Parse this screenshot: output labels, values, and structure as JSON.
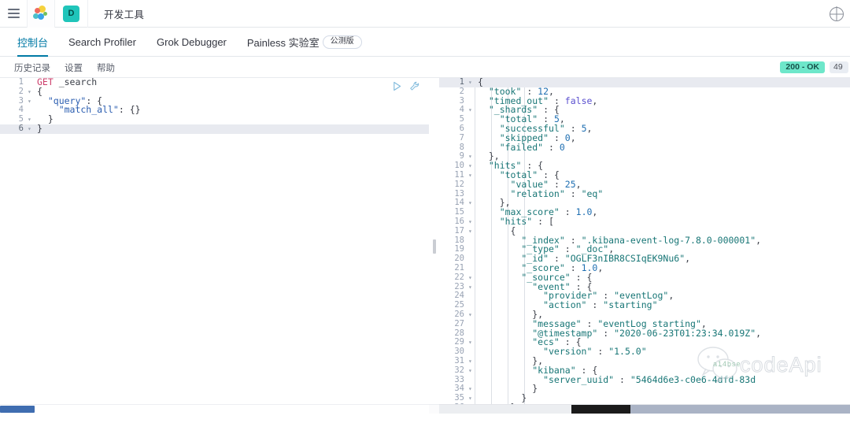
{
  "header": {
    "menu_icon": "hamburger-menu-icon",
    "logo_icon": "kibana-logo-icon",
    "space_badge": "D",
    "breadcrumb": "开发工具",
    "right_icon": "globe-icon"
  },
  "app_tabs": [
    {
      "label": "控制台",
      "active": true
    },
    {
      "label": "Search Profiler",
      "active": false
    },
    {
      "label": "Grok Debugger",
      "active": false
    },
    {
      "label": "Painless 实验室",
      "active": false
    }
  ],
  "beta_badge": "公测版",
  "console_toolbar": {
    "items": [
      "历史记录",
      "设置",
      "帮助"
    ],
    "status": "200 - OK",
    "time": "49",
    "status_color": "#6ee7ca"
  },
  "editor_actions": {
    "play": "play-icon",
    "wrench": "wrench-icon"
  },
  "request_editor": {
    "lines": [
      {
        "num": "1",
        "fold": "",
        "current": false,
        "parts": [
          {
            "t": "GET",
            "c": "tok-method"
          },
          {
            "t": " _search",
            "c": "tok-url"
          }
        ]
      },
      {
        "num": "2",
        "fold": "▾",
        "current": false,
        "parts": [
          {
            "t": "{",
            "c": "tok-punct"
          }
        ]
      },
      {
        "num": "3",
        "fold": "▾",
        "current": false,
        "parts": [
          {
            "t": "  \"query\"",
            "c": "tok-key"
          },
          {
            "t": ": {",
            "c": "tok-punct"
          }
        ]
      },
      {
        "num": "4",
        "fold": "",
        "current": false,
        "parts": [
          {
            "t": "    \"match_all\"",
            "c": "tok-key"
          },
          {
            "t": ": {}",
            "c": "tok-punct"
          }
        ]
      },
      {
        "num": "5",
        "fold": "▾",
        "current": false,
        "parts": [
          {
            "t": "  }",
            "c": "tok-punct"
          }
        ]
      },
      {
        "num": "6",
        "fold": "▾",
        "current": true,
        "parts": [
          {
            "t": "}",
            "c": "tok-punct"
          }
        ]
      }
    ]
  },
  "response_editor": {
    "lines": [
      {
        "num": "1",
        "fold": "▾",
        "current": true,
        "parts": [
          {
            "t": "{",
            "c": "r-punct"
          }
        ]
      },
      {
        "num": "2",
        "fold": "",
        "current": false,
        "parts": [
          {
            "t": "  \"took\"",
            "c": "r-key"
          },
          {
            "t": " : ",
            "c": "r-punct"
          },
          {
            "t": "12",
            "c": "r-num"
          },
          {
            "t": ",",
            "c": "r-punct"
          }
        ]
      },
      {
        "num": "3",
        "fold": "",
        "current": false,
        "parts": [
          {
            "t": "  \"timed_out\"",
            "c": "r-key"
          },
          {
            "t": " : ",
            "c": "r-punct"
          },
          {
            "t": "false",
            "c": "r-bool"
          },
          {
            "t": ",",
            "c": "r-punct"
          }
        ]
      },
      {
        "num": "4",
        "fold": "▾",
        "current": false,
        "parts": [
          {
            "t": "  \"_shards\"",
            "c": "r-key"
          },
          {
            "t": " : {",
            "c": "r-punct"
          }
        ]
      },
      {
        "num": "5",
        "fold": "",
        "current": false,
        "parts": [
          {
            "t": "    \"total\"",
            "c": "r-key"
          },
          {
            "t": " : ",
            "c": "r-punct"
          },
          {
            "t": "5",
            "c": "r-num"
          },
          {
            "t": ",",
            "c": "r-punct"
          }
        ]
      },
      {
        "num": "6",
        "fold": "",
        "current": false,
        "parts": [
          {
            "t": "    \"successful\"",
            "c": "r-key"
          },
          {
            "t": " : ",
            "c": "r-punct"
          },
          {
            "t": "5",
            "c": "r-num"
          },
          {
            "t": ",",
            "c": "r-punct"
          }
        ]
      },
      {
        "num": "7",
        "fold": "",
        "current": false,
        "parts": [
          {
            "t": "    \"skipped\"",
            "c": "r-key"
          },
          {
            "t": " : ",
            "c": "r-punct"
          },
          {
            "t": "0",
            "c": "r-num"
          },
          {
            "t": ",",
            "c": "r-punct"
          }
        ]
      },
      {
        "num": "8",
        "fold": "",
        "current": false,
        "parts": [
          {
            "t": "    \"failed\"",
            "c": "r-key"
          },
          {
            "t": " : ",
            "c": "r-punct"
          },
          {
            "t": "0",
            "c": "r-num"
          }
        ]
      },
      {
        "num": "9",
        "fold": "▾",
        "current": false,
        "parts": [
          {
            "t": "  },",
            "c": "r-punct"
          }
        ]
      },
      {
        "num": "10",
        "fold": "▾",
        "current": false,
        "parts": [
          {
            "t": "  \"hits\"",
            "c": "r-key"
          },
          {
            "t": " : {",
            "c": "r-punct"
          }
        ]
      },
      {
        "num": "11",
        "fold": "▾",
        "current": false,
        "parts": [
          {
            "t": "    \"total\"",
            "c": "r-key"
          },
          {
            "t": " : {",
            "c": "r-punct"
          }
        ]
      },
      {
        "num": "12",
        "fold": "",
        "current": false,
        "parts": [
          {
            "t": "      \"value\"",
            "c": "r-key"
          },
          {
            "t": " : ",
            "c": "r-punct"
          },
          {
            "t": "25",
            "c": "r-num"
          },
          {
            "t": ",",
            "c": "r-punct"
          }
        ]
      },
      {
        "num": "13",
        "fold": "",
        "current": false,
        "parts": [
          {
            "t": "      \"relation\"",
            "c": "r-key"
          },
          {
            "t": " : ",
            "c": "r-punct"
          },
          {
            "t": "\"eq\"",
            "c": "r-str"
          }
        ]
      },
      {
        "num": "14",
        "fold": "▾",
        "current": false,
        "parts": [
          {
            "t": "    },",
            "c": "r-punct"
          }
        ]
      },
      {
        "num": "15",
        "fold": "",
        "current": false,
        "parts": [
          {
            "t": "    \"max_score\"",
            "c": "r-key"
          },
          {
            "t": " : ",
            "c": "r-punct"
          },
          {
            "t": "1.0",
            "c": "r-num"
          },
          {
            "t": ",",
            "c": "r-punct"
          }
        ]
      },
      {
        "num": "16",
        "fold": "▾",
        "current": false,
        "parts": [
          {
            "t": "    \"hits\"",
            "c": "r-key"
          },
          {
            "t": " : [",
            "c": "r-punct"
          }
        ]
      },
      {
        "num": "17",
        "fold": "▾",
        "current": false,
        "parts": [
          {
            "t": "      {",
            "c": "r-punct"
          }
        ]
      },
      {
        "num": "18",
        "fold": "",
        "current": false,
        "parts": [
          {
            "t": "        \"_index\"",
            "c": "r-key"
          },
          {
            "t": " : ",
            "c": "r-punct"
          },
          {
            "t": "\".kibana-event-log-7.8.0-000001\"",
            "c": "r-str"
          },
          {
            "t": ",",
            "c": "r-punct"
          }
        ]
      },
      {
        "num": "19",
        "fold": "",
        "current": false,
        "parts": [
          {
            "t": "        \"_type\"",
            "c": "r-key"
          },
          {
            "t": " : ",
            "c": "r-punct"
          },
          {
            "t": "\"_doc\"",
            "c": "r-str"
          },
          {
            "t": ",",
            "c": "r-punct"
          }
        ]
      },
      {
        "num": "20",
        "fold": "",
        "current": false,
        "parts": [
          {
            "t": "        \"_id\"",
            "c": "r-key"
          },
          {
            "t": " : ",
            "c": "r-punct"
          },
          {
            "t": "\"OGLF3nIBR8CSIqEK9Nu6\"",
            "c": "r-str"
          },
          {
            "t": ",",
            "c": "r-punct"
          }
        ]
      },
      {
        "num": "21",
        "fold": "",
        "current": false,
        "parts": [
          {
            "t": "        \"_score\"",
            "c": "r-key"
          },
          {
            "t": " : ",
            "c": "r-punct"
          },
          {
            "t": "1.0",
            "c": "r-num"
          },
          {
            "t": ",",
            "c": "r-punct"
          }
        ]
      },
      {
        "num": "22",
        "fold": "▾",
        "current": false,
        "parts": [
          {
            "t": "        \"_source\"",
            "c": "r-key"
          },
          {
            "t": " : {",
            "c": "r-punct"
          }
        ]
      },
      {
        "num": "23",
        "fold": "▾",
        "current": false,
        "parts": [
          {
            "t": "          \"event\"",
            "c": "r-key"
          },
          {
            "t": " : {",
            "c": "r-punct"
          }
        ]
      },
      {
        "num": "24",
        "fold": "",
        "current": false,
        "parts": [
          {
            "t": "            \"provider\"",
            "c": "r-key"
          },
          {
            "t": " : ",
            "c": "r-punct"
          },
          {
            "t": "\"eventLog\"",
            "c": "r-str"
          },
          {
            "t": ",",
            "c": "r-punct"
          }
        ]
      },
      {
        "num": "25",
        "fold": "",
        "current": false,
        "parts": [
          {
            "t": "            \"action\"",
            "c": "r-key"
          },
          {
            "t": " : ",
            "c": "r-punct"
          },
          {
            "t": "\"starting\"",
            "c": "r-str"
          }
        ]
      },
      {
        "num": "26",
        "fold": "▾",
        "current": false,
        "parts": [
          {
            "t": "          },",
            "c": "r-punct"
          }
        ]
      },
      {
        "num": "27",
        "fold": "",
        "current": false,
        "parts": [
          {
            "t": "          \"message\"",
            "c": "r-key"
          },
          {
            "t": " : ",
            "c": "r-punct"
          },
          {
            "t": "\"eventLog starting\"",
            "c": "r-str"
          },
          {
            "t": ",",
            "c": "r-punct"
          }
        ]
      },
      {
        "num": "28",
        "fold": "",
        "current": false,
        "parts": [
          {
            "t": "          \"@timestamp\"",
            "c": "r-key"
          },
          {
            "t": " : ",
            "c": "r-punct"
          },
          {
            "t": "\"2020-06-23T01:23:34.019Z\"",
            "c": "r-str"
          },
          {
            "t": ",",
            "c": "r-punct"
          }
        ]
      },
      {
        "num": "29",
        "fold": "▾",
        "current": false,
        "parts": [
          {
            "t": "          \"ecs\"",
            "c": "r-key"
          },
          {
            "t": " : {",
            "c": "r-punct"
          }
        ]
      },
      {
        "num": "30",
        "fold": "",
        "current": false,
        "parts": [
          {
            "t": "            \"version\"",
            "c": "r-key"
          },
          {
            "t": " : ",
            "c": "r-punct"
          },
          {
            "t": "\"1.5.0\"",
            "c": "r-str"
          }
        ]
      },
      {
        "num": "31",
        "fold": "▾",
        "current": false,
        "parts": [
          {
            "t": "          },",
            "c": "r-punct"
          }
        ]
      },
      {
        "num": "32",
        "fold": "▾",
        "current": false,
        "parts": [
          {
            "t": "          \"kibana\"",
            "c": "r-key"
          },
          {
            "t": " : {",
            "c": "r-punct"
          }
        ]
      },
      {
        "num": "33",
        "fold": "",
        "current": false,
        "parts": [
          {
            "t": "            \"server_uuid\"",
            "c": "r-key"
          },
          {
            "t": " : ",
            "c": "r-punct"
          },
          {
            "t": "\"5464d6e3-c0e6-4dfd-83d",
            "c": "r-str"
          }
        ]
      },
      {
        "num": "34",
        "fold": "▾",
        "current": false,
        "parts": [
          {
            "t": "          }",
            "c": "r-punct"
          }
        ]
      },
      {
        "num": "35",
        "fold": "▾",
        "current": false,
        "parts": [
          {
            "t": "        }",
            "c": "r-punct"
          }
        ]
      },
      {
        "num": "36",
        "fold": "▾",
        "current": false,
        "parts": [
          {
            "t": "      },",
            "c": "r-punct"
          }
        ]
      }
    ]
  },
  "watermark": {
    "text": "codeApi",
    "overlay": "a14bse"
  }
}
